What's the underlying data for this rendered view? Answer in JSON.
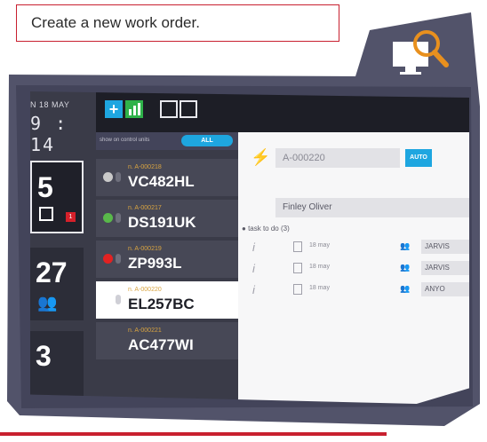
{
  "caption": "Create a new work order.",
  "clock": {
    "date": "N 18 MAY",
    "time": "9 : 14"
  },
  "cards": [
    {
      "number": "5",
      "badge": "1"
    },
    {
      "number": "27"
    },
    {
      "number": "3"
    }
  ],
  "toolbar": {
    "plus_icon": "plus-icon",
    "chart_icon": "bar-chart-icon",
    "list_icon": "list-icon",
    "calendar_icon": "calendar-icon"
  },
  "filter": {
    "label": "show on control units",
    "toggle": "ALL"
  },
  "vehicles": [
    {
      "code": "n. A-000218",
      "plate": "VC482HL",
      "status_color": "#c9c9c9"
    },
    {
      "code": "n. A-000217",
      "plate": "DS191UK",
      "status_color": "#59b94a"
    },
    {
      "code": "n. A-000219",
      "plate": "ZP993L",
      "status_color": "#e32222"
    },
    {
      "code": "n. A-000220",
      "plate": "EL257BC",
      "status_color": "#ffffff"
    },
    {
      "code": "n. A-000221",
      "plate": "AC477WI",
      "status_color": ""
    }
  ],
  "detail": {
    "order_number": "A-000220",
    "auto_label": "AUTO",
    "assignee": "Finley Oliver",
    "tasks_header": "task to do (3)",
    "tasks": [
      {
        "date": "18 may",
        "who": "JARVIS"
      },
      {
        "date": "18 may",
        "who": "JARVIS"
      },
      {
        "date": "18 may",
        "who": "ANYO"
      }
    ]
  },
  "colors": {
    "accent_red": "#c8202f",
    "accent_blue": "#1ea6e0",
    "magnifier": "#e8901e"
  }
}
